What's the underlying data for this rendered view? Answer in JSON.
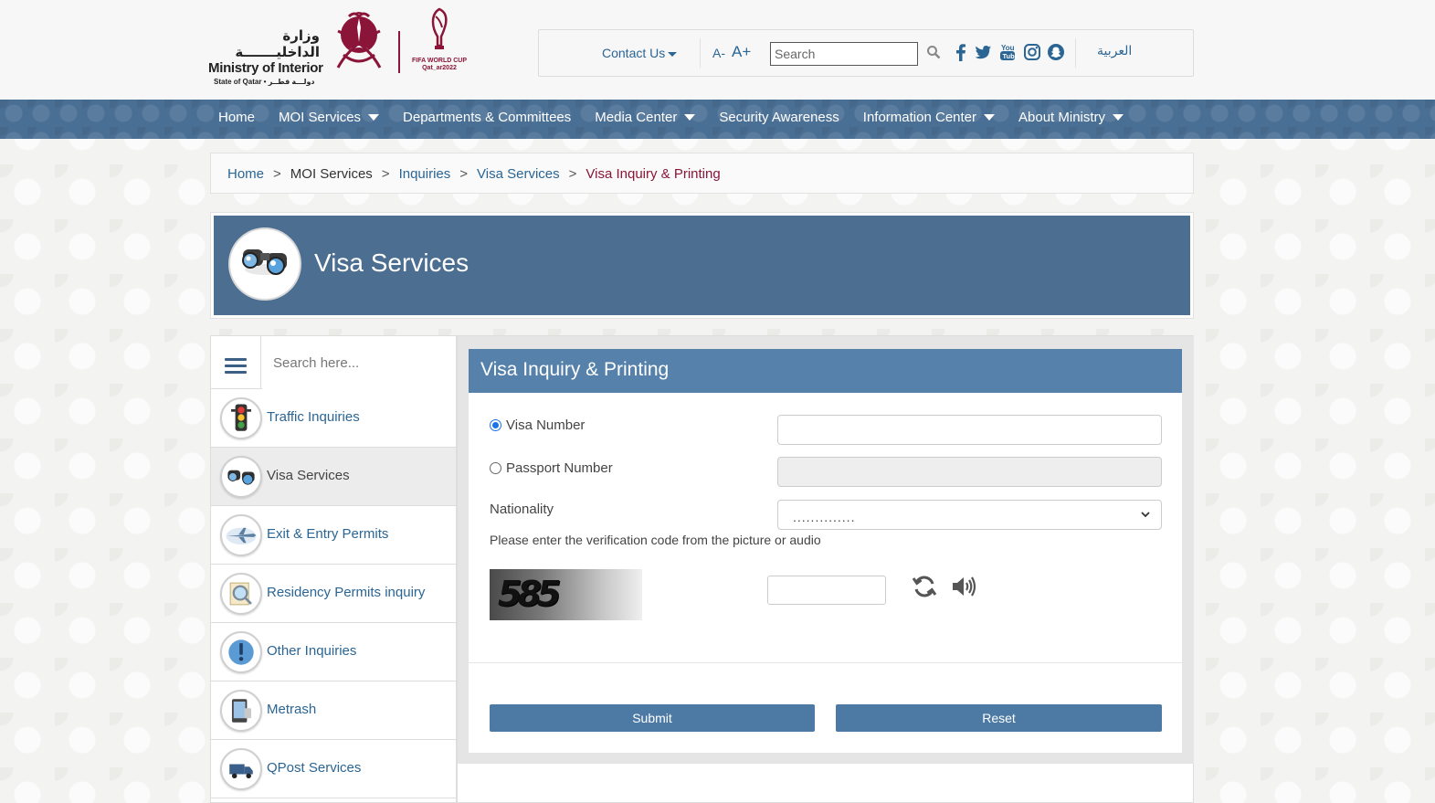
{
  "header": {
    "logo": {
      "arabic": "وزارة الداخليـــــــة",
      "english": "Ministry of Interior",
      "subtitle": "State of Qatar • دولـــة قطــر",
      "worldcup_line1": "FIFA WORLD CUP",
      "worldcup_line2": "Qat_ar2022"
    },
    "contact_label": "Contact Us",
    "font_decrease": "A-",
    "font_increase": "A+",
    "search_placeholder": "Search",
    "social_icons": [
      "facebook-icon",
      "twitter-icon",
      "youtube-icon",
      "instagram-icon",
      "snapchat-icon"
    ],
    "language_link": "العربية"
  },
  "nav": {
    "items": [
      {
        "label": "Home",
        "dropdown": false
      },
      {
        "label": "MOI Services",
        "dropdown": true
      },
      {
        "label": "Departments & Committees",
        "dropdown": false
      },
      {
        "label": "Media Center",
        "dropdown": true
      },
      {
        "label": "Security Awareness",
        "dropdown": false
      },
      {
        "label": "Information Center",
        "dropdown": true
      },
      {
        "label": "About Ministry",
        "dropdown": true
      }
    ]
  },
  "breadcrumb": {
    "items": [
      {
        "label": "Home",
        "type": "link"
      },
      {
        "label": "MOI Services",
        "type": "plain"
      },
      {
        "label": "Inquiries",
        "type": "link"
      },
      {
        "label": "Visa Services",
        "type": "link"
      },
      {
        "label": "Visa Inquiry & Printing",
        "type": "active"
      }
    ],
    "separator": ">"
  },
  "banner": {
    "title": "Visa Services",
    "icon": "binoculars-icon"
  },
  "sidebar": {
    "search_placeholder": "Search here...",
    "items": [
      {
        "label": "Traffic Inquiries",
        "icon": "traffic-light-icon",
        "active": false
      },
      {
        "label": "Visa Services",
        "icon": "binoculars-icon",
        "active": true
      },
      {
        "label": "Exit & Entry Permits",
        "icon": "airplane-icon",
        "active": false
      },
      {
        "label": "Residency Permits inquiry",
        "icon": "magnifier-document-icon",
        "active": false
      },
      {
        "label": "Other Inquiries",
        "icon": "exclamation-icon",
        "active": false
      },
      {
        "label": "Metrash",
        "icon": "mobile-phone-icon",
        "active": false
      },
      {
        "label": "QPost Services",
        "icon": "delivery-van-icon",
        "active": false
      }
    ]
  },
  "form": {
    "title": "Visa Inquiry & Printing",
    "visa_number_label": "Visa Number",
    "visa_number_value": "",
    "passport_number_label": "Passport Number",
    "passport_number_value": "",
    "selected_option": "Visa Number",
    "nationality_label": "Nationality",
    "nationality_value": "..............",
    "verification_text": "Please enter the verification code from the picture or audio",
    "captcha_code": "585",
    "captcha_input_value": "",
    "submit_label": "Submit",
    "reset_label": "Reset"
  },
  "colors": {
    "nav_bg": "#4a6f94",
    "banner_bg": "#4b6e91",
    "form_header_bg": "#5581aa",
    "button_bg": "#4d7aa5",
    "link": "#2a6594",
    "active_breadcrumb": "#8a1538"
  }
}
